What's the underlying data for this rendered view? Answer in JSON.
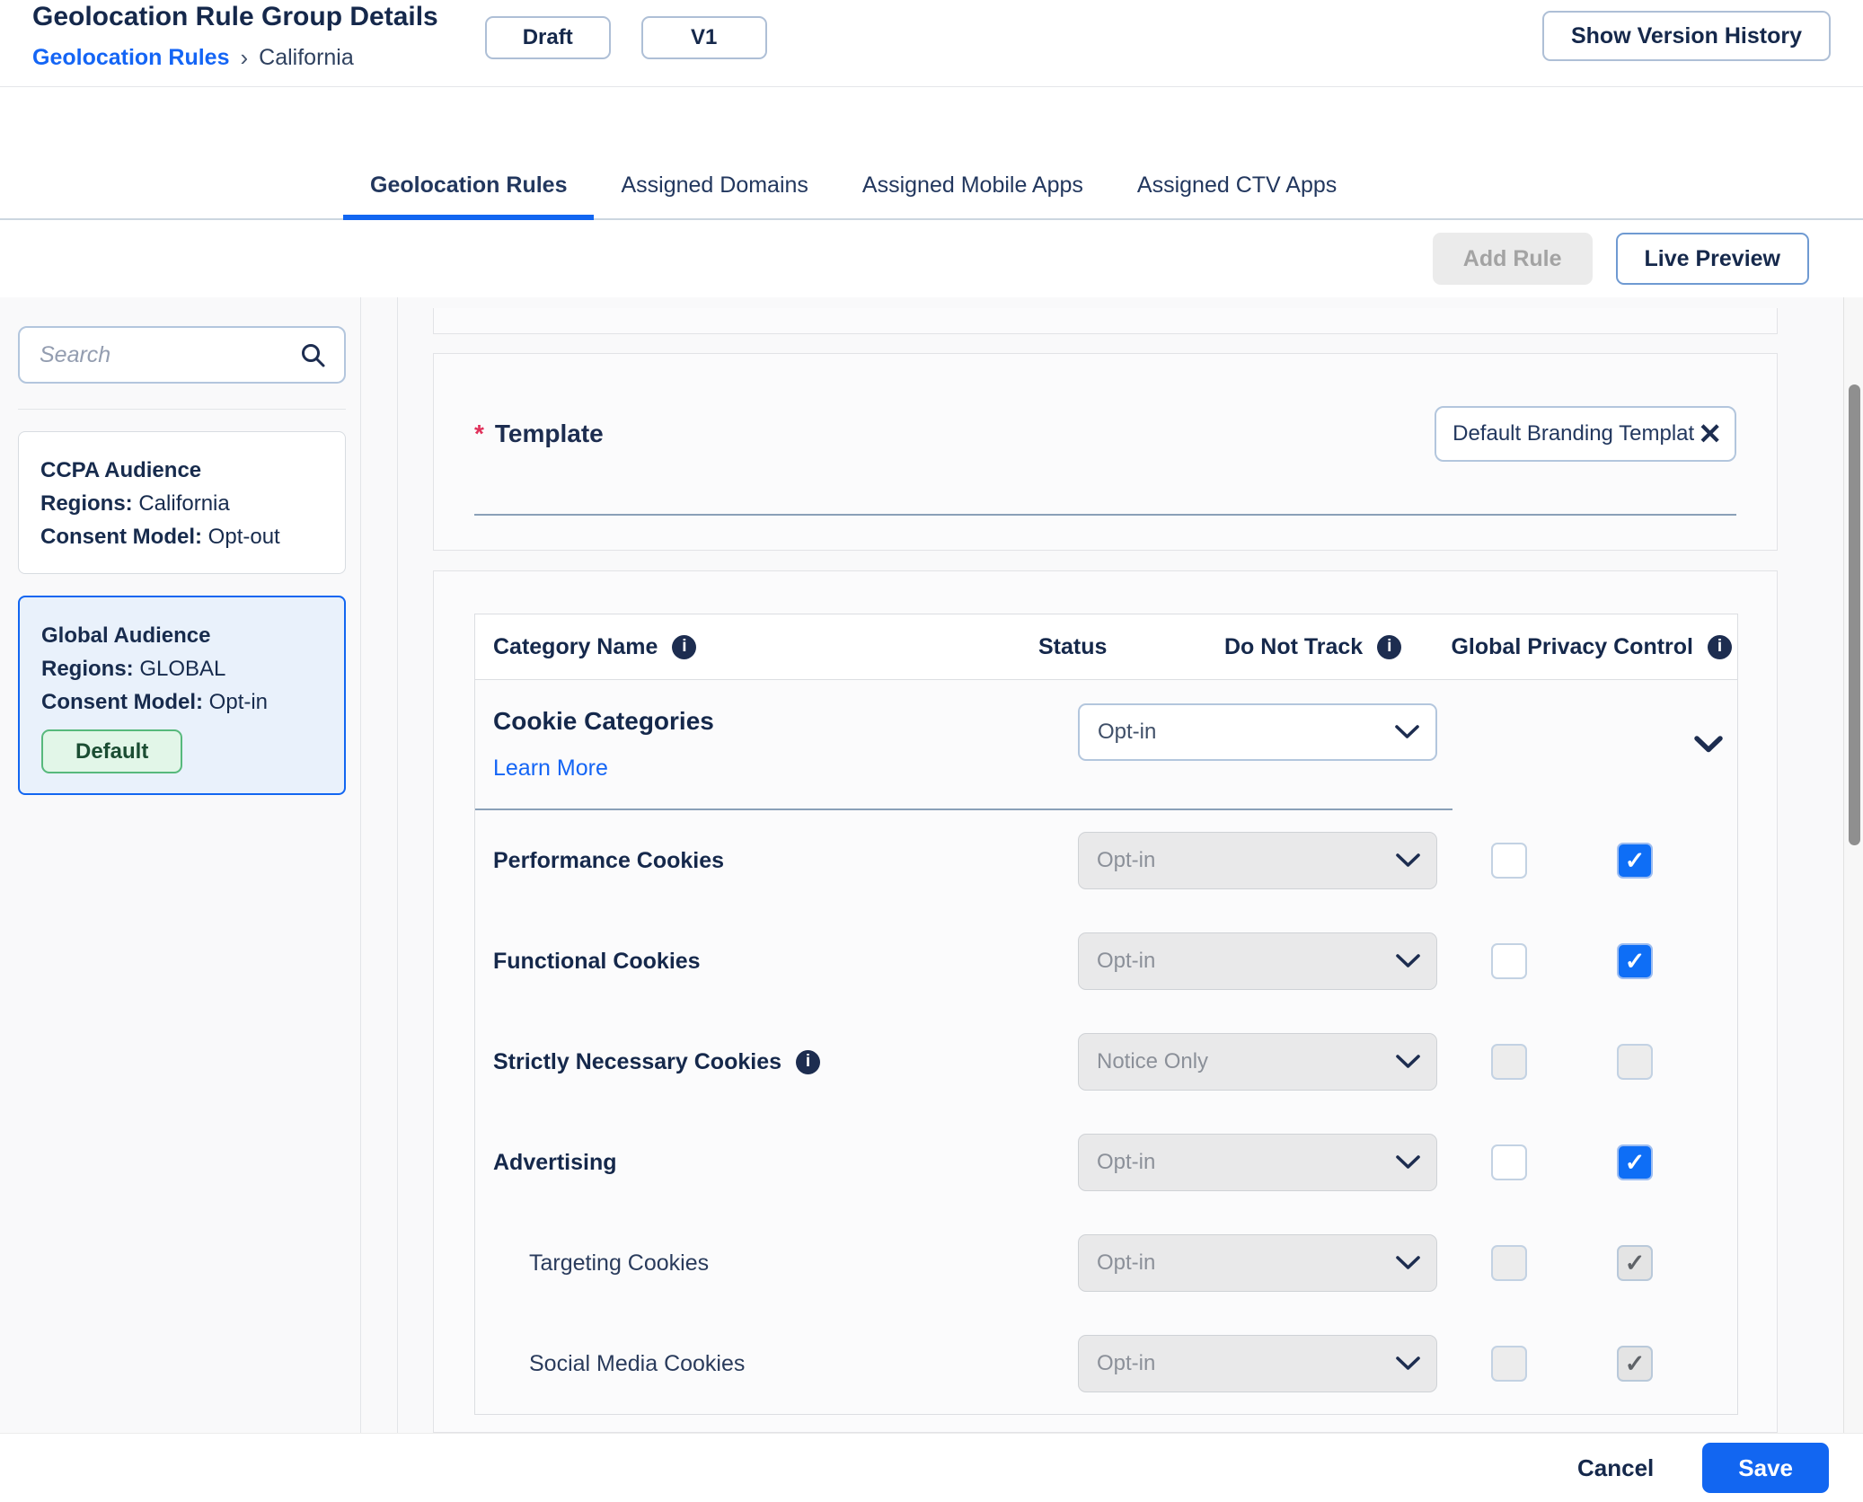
{
  "header": {
    "title": "Geolocation Rule Group Details",
    "breadcrumb": {
      "link": "Geolocation Rules",
      "separator": "›",
      "current": "California"
    },
    "status_badge": "Draft",
    "version_badge": "V1",
    "version_history_label": "Show Version History"
  },
  "tabs": [
    {
      "label": "Geolocation Rules",
      "active": true
    },
    {
      "label": "Assigned Domains",
      "active": false
    },
    {
      "label": "Assigned Mobile Apps",
      "active": false
    },
    {
      "label": "Assigned CTV Apps",
      "active": false
    }
  ],
  "toolbar": {
    "add_rule_label": "Add Rule",
    "live_preview_label": "Live Preview"
  },
  "sidebar": {
    "search_placeholder": "Search",
    "audiences": [
      {
        "name": "CCPA Audience",
        "regions_label": "Regions:",
        "regions": "California",
        "consent_label": "Consent Model:",
        "consent": "Opt-out",
        "default_badge": "",
        "selected": false
      },
      {
        "name": "Global Audience",
        "regions_label": "Regions:",
        "regions": "GLOBAL",
        "consent_label": "Consent Model:",
        "consent": "Opt-in",
        "default_badge": "Default",
        "selected": true
      }
    ]
  },
  "template_section": {
    "required_marker": "*",
    "label": "Template",
    "chip_text": "Default Branding Templat"
  },
  "table": {
    "headers": {
      "category": "Category Name",
      "status": "Status",
      "dnt": "Do Not Track",
      "gpc": "Global Privacy Control"
    },
    "group": {
      "name": "Cookie Categories",
      "learn_more": "Learn More",
      "status": "Opt-in"
    },
    "rows": [
      {
        "name": "Performance Cookies",
        "info": false,
        "indent": false,
        "status": "Opt-in",
        "status_disabled": true,
        "dnt_checked": false,
        "dnt_disabled": false,
        "gpc_checked": true,
        "gpc_disabled": false
      },
      {
        "name": "Functional Cookies",
        "info": false,
        "indent": false,
        "status": "Opt-in",
        "status_disabled": true,
        "dnt_checked": false,
        "dnt_disabled": false,
        "gpc_checked": true,
        "gpc_disabled": false
      },
      {
        "name": "Strictly Necessary Cookies",
        "info": true,
        "indent": false,
        "status": "Notice Only",
        "status_disabled": true,
        "dnt_checked": false,
        "dnt_disabled": true,
        "gpc_checked": false,
        "gpc_disabled": true
      },
      {
        "name": "Advertising",
        "info": false,
        "indent": false,
        "status": "Opt-in",
        "status_disabled": true,
        "dnt_checked": false,
        "dnt_disabled": false,
        "gpc_checked": true,
        "gpc_disabled": false
      },
      {
        "name": "Targeting Cookies",
        "info": false,
        "indent": true,
        "status": "Opt-in",
        "status_disabled": true,
        "dnt_checked": false,
        "dnt_disabled": true,
        "gpc_checked": true,
        "gpc_disabled": true
      },
      {
        "name": "Social Media Cookies",
        "info": false,
        "indent": true,
        "status": "Opt-in",
        "status_disabled": true,
        "dnt_checked": false,
        "dnt_disabled": true,
        "gpc_checked": true,
        "gpc_disabled": true
      }
    ]
  },
  "footer": {
    "cancel_label": "Cancel",
    "save_label": "Save"
  },
  "icons": {
    "info": "i",
    "close": "✕",
    "checkmark": "✓",
    "breadcrumb_separator": "›"
  },
  "colors": {
    "accent_blue": "#1266f1",
    "checked_checkbox_blue": "#0e6ef6",
    "navy_text": "#15284b",
    "selected_card_bg": "#e9f1fb",
    "default_badge_bg": "#e2f6e8",
    "default_badge_border": "#57b97c",
    "required_marker_red": "#e0315b",
    "disabled_field_bg": "#e9e9ea"
  }
}
